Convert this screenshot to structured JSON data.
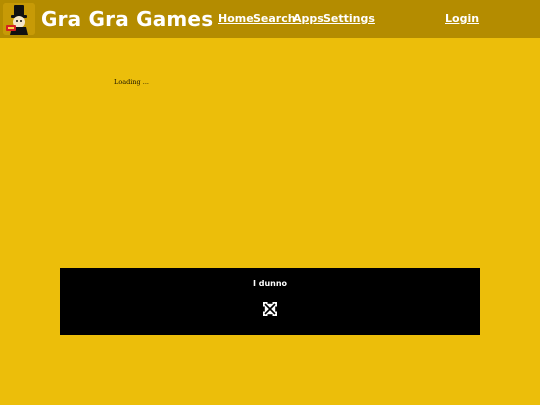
{
  "header": {
    "logo": "gra-gra-mascot-logo",
    "title": "Gra Gra Games",
    "nav": {
      "home": "Home",
      "search": "Search",
      "apps": "Apps",
      "settings": "Settings",
      "login": "Login"
    }
  },
  "main": {
    "loading_text": "Loading ..."
  },
  "game_panel": {
    "caption": "I dunno",
    "fullscreen_icon": "fullscreen-icon"
  },
  "colors": {
    "page_background": "#ecbe0a",
    "header_background": "#b48c00",
    "panel_background": "#000000",
    "text_light": "#ffffff"
  }
}
